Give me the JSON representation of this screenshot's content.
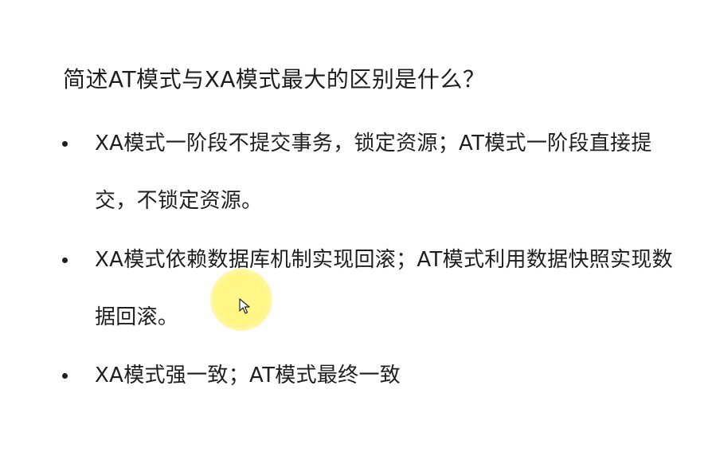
{
  "slide": {
    "title": "简述AT模式与XA模式最大的区别是什么？",
    "bullets": [
      {
        "text": "XA模式一阶段不提交事务，锁定资源；AT模式一阶段直接提交，不锁定资源。"
      },
      {
        "text": "XA模式依赖数据库机制实现回滚；AT模式利用数据快照实现数据回滚。"
      },
      {
        "text": "XA模式强一致；AT模式最终一致"
      }
    ]
  },
  "cursor": {
    "icon": "mouse-pointer-icon",
    "highlight_color": "#fff35a"
  }
}
